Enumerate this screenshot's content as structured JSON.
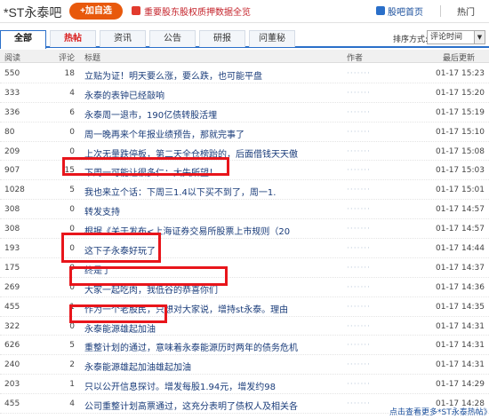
{
  "header": {
    "forum_title": "*ST永泰吧",
    "add_button": "+加自选",
    "ad_text": "重要股东股权质押数据全览",
    "home_link": "股吧首页",
    "hot_link": "热门"
  },
  "tabs": [
    {
      "label": "全部"
    },
    {
      "label": "热帖"
    },
    {
      "label": "资讯"
    },
    {
      "label": "公告"
    },
    {
      "label": "研报"
    },
    {
      "label": "问董秘"
    }
  ],
  "sort": {
    "label": "排序方式:",
    "value": "评论时间"
  },
  "columns": {
    "read": "阅读",
    "comments": "评论",
    "title": "标题",
    "author": "作者",
    "time": "最后更新"
  },
  "posts": [
    {
      "read": "550",
      "comments": "18",
      "title": "立贴为证！明天要么涨，要么跌，也可能平盘",
      "author": "·······",
      "time": "01-17 15:23"
    },
    {
      "read": "333",
      "comments": "4",
      "title": "永泰的表钟已经敲响",
      "author": "·······",
      "time": "01-17 15:20"
    },
    {
      "read": "336",
      "comments": "6",
      "title": "永泰周一退市，190亿债转股活埋",
      "author": "·······",
      "time": "01-17 15:19"
    },
    {
      "read": "80",
      "comments": "0",
      "title": "周一晚再来个年报业绩预告，那就完事了",
      "author": "·······",
      "time": "01-17 15:10"
    },
    {
      "read": "209",
      "comments": "0",
      "title": "上次无量跌停板，第二天全仓榜跆的，后面借钱天天傲",
      "author": "·······",
      "time": "01-17 15:08"
    },
    {
      "read": "907",
      "comments": "15",
      "title": "下周一可能让很多仁：大失所望！",
      "author": "·······",
      "time": "01-17 15:03"
    },
    {
      "read": "1028",
      "comments": "5",
      "title": "我也来立个话：下周三1.4以下买不到了，周一1.",
      "author": "·······",
      "time": "01-17 15:01"
    },
    {
      "read": "308",
      "comments": "0",
      "title": "转发支持",
      "author": "·······",
      "time": "01-17 14:57"
    },
    {
      "read": "308",
      "comments": "0",
      "title": "根据《关于发布<上海证券交易所股票上市规则（20",
      "author": "·······",
      "time": "01-17 14:57"
    },
    {
      "read": "193",
      "comments": "0",
      "title": "这下子永泰好玩了",
      "author": "·······",
      "time": "01-17 14:44"
    },
    {
      "read": "175",
      "comments": "0",
      "title": "终是了",
      "author": "·······",
      "time": "01-17 14:37"
    },
    {
      "read": "269",
      "comments": "0",
      "title": "大家一起吃肉，我低谷的恭喜你们",
      "author": "·······",
      "time": "01-17 14:36"
    },
    {
      "read": "455",
      "comments": "1",
      "title": "作为一个老股民，只想对大家说，增持st永泰。理由",
      "author": "·······",
      "time": "01-17 14:35"
    },
    {
      "read": "322",
      "comments": "0",
      "title": "永泰能源雄起加油",
      "author": "·······",
      "time": "01-17 14:31"
    },
    {
      "read": "626",
      "comments": "5",
      "title": "重整计划的通过，意味着永泰能源历时两年的债务危机",
      "author": "·······",
      "time": "01-17 14:31"
    },
    {
      "read": "240",
      "comments": "2",
      "title": "永泰能源雄起加油雄起加油",
      "author": "·······",
      "time": "01-17 14:31"
    },
    {
      "read": "203",
      "comments": "1",
      "title": "只以公开信息探讨。增发每股1.94元，增发约98",
      "author": "·······",
      "time": "01-17 14:29"
    },
    {
      "read": "455",
      "comments": "4",
      "title": "公司重整计划高票通过，这充分表明了债权人及相关各",
      "author": "·······",
      "time": "01-17 14:28"
    }
  ],
  "footer": {
    "more_link": "点击查看更多*ST永泰热帖》"
  },
  "colors": {
    "accent": "#2a6fc9",
    "highlight": "#e8151b",
    "add_button": "#e8590c"
  }
}
